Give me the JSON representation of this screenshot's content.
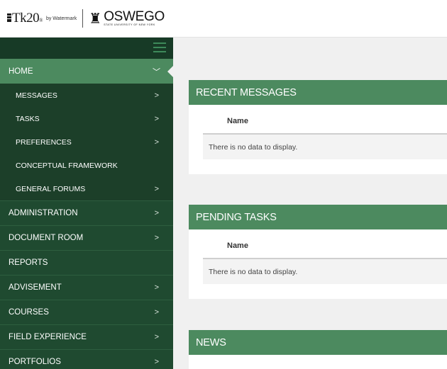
{
  "header": {
    "tk20_brand": "Tk20",
    "byline": "by Watermark",
    "university_name": "OSWEGO",
    "university_sub": "STATE UNIVERSITY OF NEW YORK"
  },
  "sidebar": {
    "items": [
      {
        "label": "HOME",
        "active": true,
        "expanded": true
      },
      {
        "label": "ADMINISTRATION"
      },
      {
        "label": "DOCUMENT ROOM"
      },
      {
        "label": "REPORTS"
      },
      {
        "label": "ADVISEMENT"
      },
      {
        "label": "COURSES"
      },
      {
        "label": "FIELD EXPERIENCE"
      },
      {
        "label": "PORTFOLIOS"
      }
    ],
    "home_subitems": [
      {
        "label": "MESSAGES"
      },
      {
        "label": "TASKS"
      },
      {
        "label": "PREFERENCES"
      },
      {
        "label": "CONCEPTUAL FRAMEWORK"
      },
      {
        "label": "GENERAL FORUMS"
      }
    ]
  },
  "main": {
    "panels": [
      {
        "title": "RECENT MESSAGES",
        "column_header": "Name",
        "empty_text": "There is no data to display."
      },
      {
        "title": "PENDING TASKS",
        "column_header": "Name",
        "empty_text": "There is no data to display."
      },
      {
        "title": "NEWS"
      }
    ]
  },
  "colors": {
    "sidebar_bg": "#1f4a30",
    "accent_green": "#4c8a5f",
    "sub_item_bg": "#1c3f29"
  },
  "icons": {
    "menu": "hamburger-icon",
    "chevron": "chevron-right-icon",
    "chevron_down": "chevron-down-icon"
  }
}
